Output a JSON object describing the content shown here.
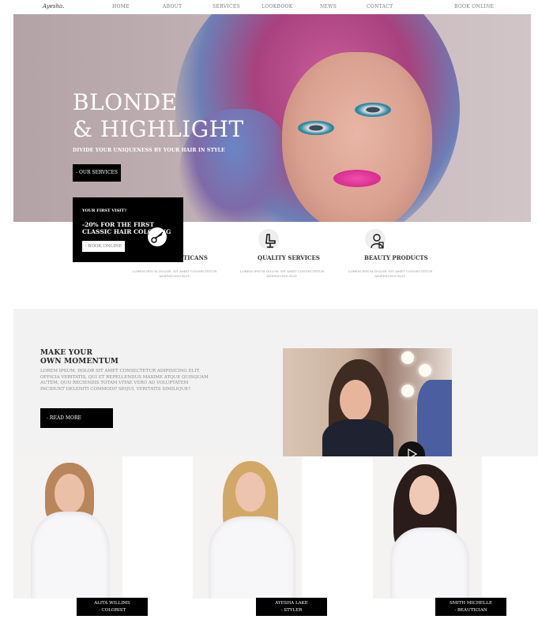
{
  "nav": {
    "logo": "Ayesha.",
    "links": [
      "HOME",
      "ABOUT",
      "SERVICES",
      "LOOKBOOK",
      "NEWS",
      "CONTACT",
      "BOOK ONLINE"
    ]
  },
  "hero": {
    "title_line1": "BLONDE",
    "title_line2": "& HIGHLIGHT",
    "subtitle": "DIVIDE YOUR UNIQUENESS BY YOUR HAIR IN STYLE",
    "button": "- OUR SERVICES"
  },
  "promo": {
    "kicker": "YOUR FIRST VISIT?",
    "offer": "-20% FOR THE FIRST CLASSIC HAIR COLORING",
    "button": "- BOOK ONLINE"
  },
  "features": [
    {
      "title": "TICANS",
      "desc": "LOREM IPSUM DOLOR, SIT AMET CONSECTETUR ADIPISICING ELIT."
    },
    {
      "title": "QUALITY SERVICES",
      "desc": "LOREM IPSUM DOLOR, SIT AMET CONSECTETUR ADIPISICING ELIT."
    },
    {
      "title": "BEAUTY PRODUCTS",
      "desc": "LOREM IPSUM DOLOR, SIT AMET CONSECTETUR ADIPISICING ELIT."
    }
  ],
  "momentum": {
    "heading_line1": "MAKE YOUR",
    "heading_line2": "OWN MOMENTUM",
    "paragraph": "LOREM IPSUM, DOLOR SIT AMET CONSECTETUR ADIPISICING ELIT. OFFICIA VERITATIS, QUI ET REPELLENDUS MAXIME ATQUE QUISQUAM AUTEM, QUO RECIENDIS TOTAM VITAE VERO AD VOLUPTATEM INCIDUNT DELENITI COMMODI? SEQUI, VERITATIS SIMILIQUE?",
    "button": "- READ MORE"
  },
  "team": [
    {
      "name": "ALITA WILLIMS",
      "role": "- COLORIST"
    },
    {
      "name": "AYESHA LAKE",
      "role": "- STYLER"
    },
    {
      "name": "SMITH MICHELLE",
      "role": "- BEAUTICIAN"
    }
  ],
  "colors": {
    "accent": "#000000",
    "panel": "#f2f2f3",
    "hero_bg": "#bdadb0"
  }
}
